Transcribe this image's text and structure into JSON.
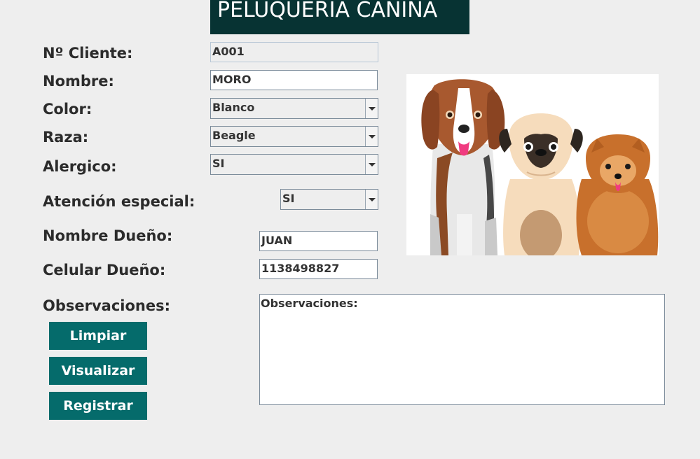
{
  "header": {
    "title": "PELUQUERIA CANINA"
  },
  "form": {
    "cliente": {
      "label": "Nº Cliente:",
      "value": "A001"
    },
    "nombre": {
      "label": "Nombre:",
      "value": "MORO"
    },
    "color": {
      "label": "Color:",
      "selected": "Blanco"
    },
    "raza": {
      "label": "Raza:",
      "selected": "Beagle"
    },
    "alergico": {
      "label": "Alergico:",
      "selected": "SI"
    },
    "atencion": {
      "label": "Atención especial:",
      "selected": "SI"
    },
    "nombre_dueno": {
      "label": "Nombre Dueño:",
      "value": "JUAN"
    },
    "celular_dueno": {
      "label": "Celular Dueño:",
      "value": "1138498827"
    },
    "observaciones": {
      "label": "Observaciones:",
      "value": "Observaciones:"
    }
  },
  "buttons": {
    "limpiar": "Limpiar",
    "visualizar": "Visualizar",
    "registrar": "Registrar"
  },
  "image": {
    "subject": "dogs-illustration"
  },
  "colors": {
    "header_bg": "#073333",
    "button_bg": "#056b6b",
    "background": "#eeeeee"
  }
}
